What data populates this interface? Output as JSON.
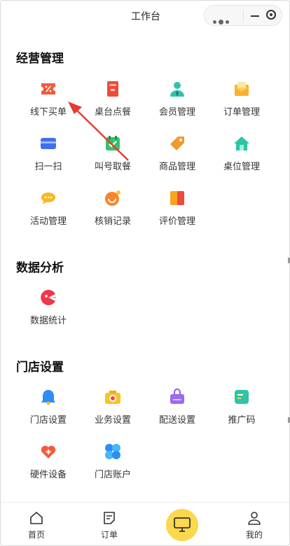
{
  "header": {
    "title": "工作台"
  },
  "sections": [
    {
      "title": "经营管理",
      "items": [
        {
          "label": "线下买单",
          "icon": "ticket-icon"
        },
        {
          "label": "桌台点餐",
          "icon": "menu-book-icon"
        },
        {
          "label": "会员管理",
          "icon": "member-icon"
        },
        {
          "label": "订单管理",
          "icon": "mail-order-icon"
        },
        {
          "label": "扫一扫",
          "icon": "scan-card-icon"
        },
        {
          "label": "叫号取餐",
          "icon": "calendar-check-icon"
        },
        {
          "label": "商品管理",
          "icon": "price-tag-icon"
        },
        {
          "label": "桌位管理",
          "icon": "house-icon"
        },
        {
          "label": "活动管理",
          "icon": "chat-bubble-icon"
        },
        {
          "label": "核销记录",
          "icon": "smile-coin-icon"
        },
        {
          "label": "评价管理",
          "icon": "review-book-icon"
        }
      ]
    },
    {
      "title": "数据分析",
      "items": [
        {
          "label": "数据统计",
          "icon": "pie-stats-icon"
        }
      ]
    },
    {
      "title": "门店设置",
      "items": [
        {
          "label": "门店设置",
          "icon": "bell-icon"
        },
        {
          "label": "业务设置",
          "icon": "camera-icon"
        },
        {
          "label": "配送设置",
          "icon": "bag-icon"
        },
        {
          "label": "推广码",
          "icon": "doc-icon"
        },
        {
          "label": "硬件设备",
          "icon": "heart-icon"
        },
        {
          "label": "门店账户",
          "icon": "account-bubbles-icon"
        }
      ]
    }
  ],
  "tabbar": {
    "home": "首页",
    "orders": "订单",
    "center_icon": "monitor-icon",
    "mine": "我的"
  },
  "colors": {
    "accent_yellow": "#fbd84d",
    "annotation_red": "#e83a2e"
  }
}
